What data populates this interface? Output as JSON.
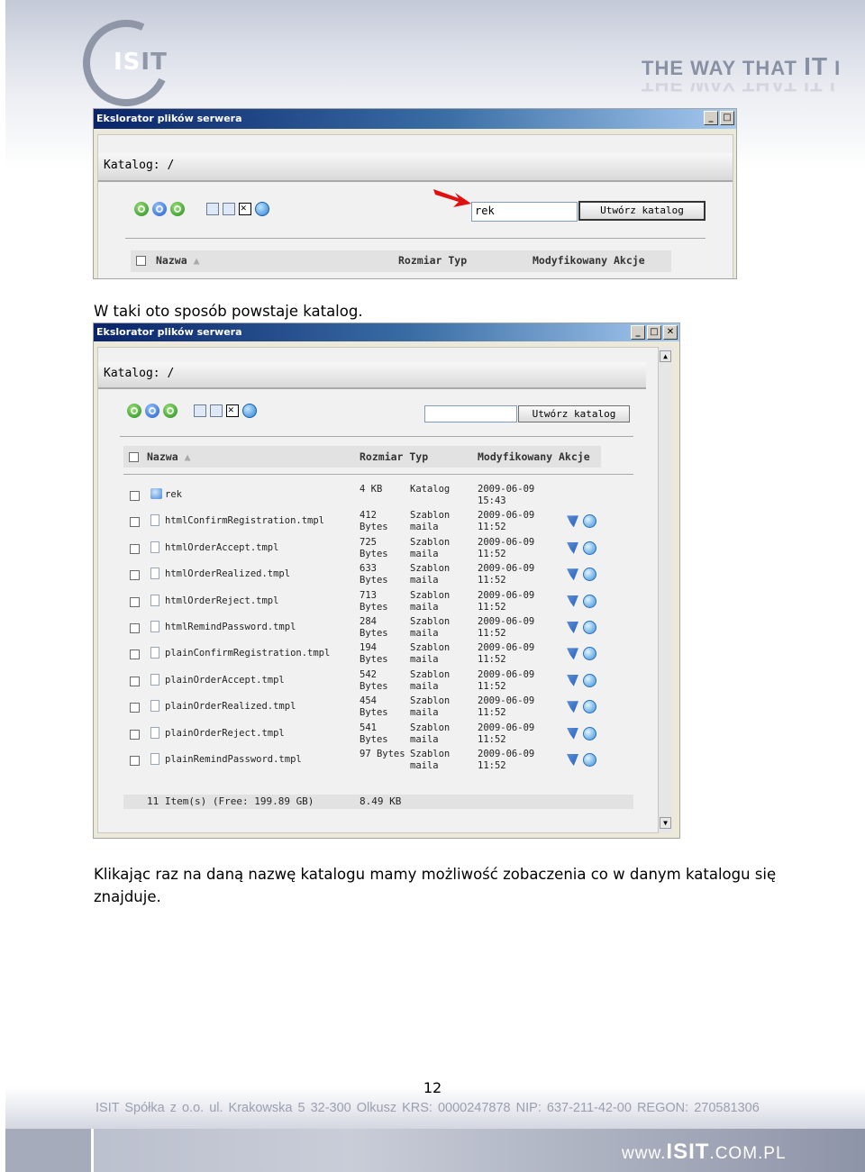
{
  "header": {
    "logo_text_1": "IS",
    "logo_text_2": "IT",
    "tagline": "THE WAY THAT IT I",
    "tagline_parts": [
      "THE WAY THAT ",
      "IT",
      " I"
    ]
  },
  "window1": {
    "title": "Ekslorator plików serwera",
    "catalog_label": "Katalog: /",
    "input_value": "rek",
    "create_button": "Utwórz katalog",
    "columns": {
      "name": "Nazwa",
      "size_type": "Rozmiar Typ",
      "modified_actions": "Modyfikowany Akcje"
    }
  },
  "caption1": "W taki oto sposób powstaje katalog.",
  "window2": {
    "title": "Ekslorator plików serwera",
    "catalog_label": "Katalog: /",
    "input_value": "",
    "create_button": "Utwórz katalog",
    "columns": {
      "name": "Nazwa",
      "size_type": "Rozmiar Typ",
      "modified_actions": "Modyfikowany Akcje"
    },
    "rows": [
      {
        "name": "rek",
        "size": "4 KB",
        "type": "Katalog",
        "date": "2009-06-09",
        "time": "15:43",
        "kind": "folder"
      },
      {
        "name": "htmlConfirmRegistration.tmpl",
        "size": "412",
        "size2": "Bytes",
        "type": "Szablon",
        "type2": "maila",
        "date": "2009-06-09",
        "time": "11:52",
        "kind": "file"
      },
      {
        "name": "htmlOrderAccept.tmpl",
        "size": "725",
        "size2": "Bytes",
        "type": "Szablon",
        "type2": "maila",
        "date": "2009-06-09",
        "time": "11:52",
        "kind": "file"
      },
      {
        "name": "htmlOrderRealized.tmpl",
        "size": "633",
        "size2": "Bytes",
        "type": "Szablon",
        "type2": "maila",
        "date": "2009-06-09",
        "time": "11:52",
        "kind": "file"
      },
      {
        "name": "htmlOrderReject.tmpl",
        "size": "713",
        "size2": "Bytes",
        "type": "Szablon",
        "type2": "maila",
        "date": "2009-06-09",
        "time": "11:52",
        "kind": "file"
      },
      {
        "name": "htmlRemindPassword.tmpl",
        "size": "284",
        "size2": "Bytes",
        "type": "Szablon",
        "type2": "maila",
        "date": "2009-06-09",
        "time": "11:52",
        "kind": "file"
      },
      {
        "name": "plainConfirmRegistration.tmpl",
        "size": "194",
        "size2": "Bytes",
        "type": "Szablon",
        "type2": "maila",
        "date": "2009-06-09",
        "time": "11:52",
        "kind": "file"
      },
      {
        "name": "plainOrderAccept.tmpl",
        "size": "542",
        "size2": "Bytes",
        "type": "Szablon",
        "type2": "maila",
        "date": "2009-06-09",
        "time": "11:52",
        "kind": "file"
      },
      {
        "name": "plainOrderRealized.tmpl",
        "size": "454",
        "size2": "Bytes",
        "type": "Szablon",
        "type2": "maila",
        "date": "2009-06-09",
        "time": "11:52",
        "kind": "file"
      },
      {
        "name": "plainOrderReject.tmpl",
        "size": "541",
        "size2": "Bytes",
        "type": "Szablon",
        "type2": "maila",
        "date": "2009-06-09",
        "time": "11:52",
        "kind": "file"
      },
      {
        "name": "plainRemindPassword.tmpl",
        "size": "97 Bytes",
        "size2": "",
        "type": "Szablon",
        "type2": "maila",
        "date": "2009-06-09",
        "time": "11:52",
        "kind": "file"
      }
    ],
    "footer_items": "11 Item(s) (Free: 199.89 GB)",
    "footer_size": "8.49 KB"
  },
  "caption2_line1": "Klikając raz na daną nazwę katalogu mamy możliwość zobaczenia co w danym katalogu się",
  "caption2_line2": "znajduje.",
  "page_number": "12",
  "footer": {
    "company_info": "ISIT Spółka z o.o.   ul. Krakowska 5   32-300 Olkusz   KRS: 0000247878   NIP: 637-211-42-00   REGON: 270581306",
    "url_pre": "www.",
    "url_brand": "ISIT",
    "url_post": ".COM.PL"
  }
}
